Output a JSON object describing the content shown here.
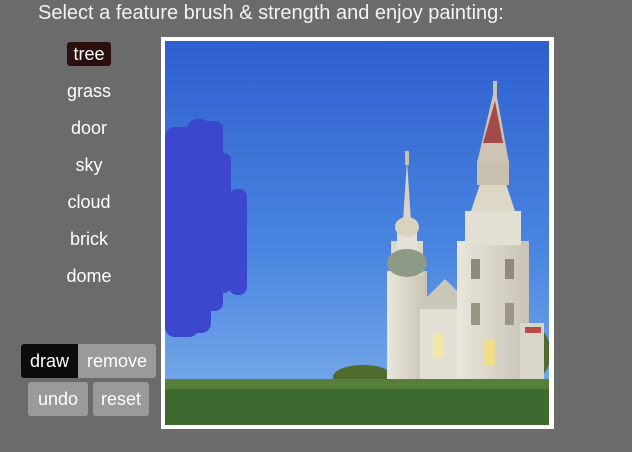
{
  "instructions": "Select a feature brush & strength and enjoy painting:",
  "brushes": [
    {
      "label": "tree",
      "selected": true
    },
    {
      "label": "grass",
      "selected": false
    },
    {
      "label": "door",
      "selected": false
    },
    {
      "label": "sky",
      "selected": false
    },
    {
      "label": "cloud",
      "selected": false
    },
    {
      "label": "brick",
      "selected": false
    },
    {
      "label": "dome",
      "selected": false
    }
  ],
  "buttons": {
    "draw": "draw",
    "remove": "remove",
    "undo": "undo",
    "reset": "reset"
  },
  "active_mode": "draw",
  "colors": {
    "background": "#6b6b6b",
    "selected_brush": "#2b0f0f",
    "active_button": "#0c0c0c",
    "inactive_button": "#9a9a9a",
    "stroke": "#3b47cc"
  }
}
